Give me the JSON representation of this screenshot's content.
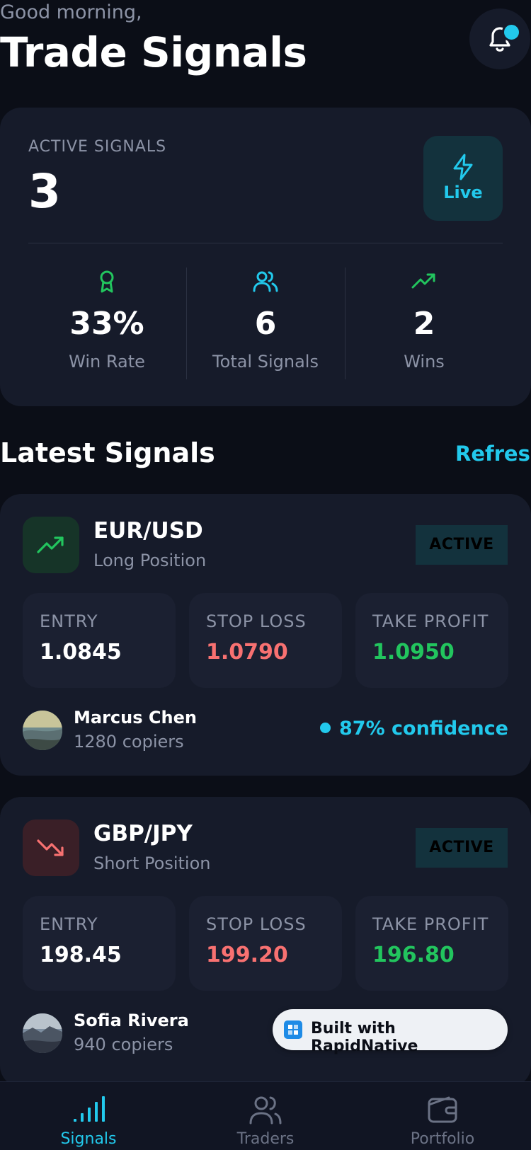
{
  "header": {
    "greeting": "Good morning,",
    "title": "Trade Signals",
    "notification_icon": "bell-icon"
  },
  "stats": {
    "active_label": "ACTIVE SIGNALS",
    "active_value": "3",
    "live_label": "Live",
    "items": [
      {
        "icon": "award-icon",
        "value": "33%",
        "label": "Win Rate",
        "color": "#22c55e"
      },
      {
        "icon": "users-icon",
        "value": "6",
        "label": "Total Signals",
        "color": "#22c9ec"
      },
      {
        "icon": "trending-up-icon",
        "value": "2",
        "label": "Wins",
        "color": "#22c55e"
      }
    ]
  },
  "latest": {
    "title": "Latest Signals",
    "refresh_label": "Refresh"
  },
  "signals": [
    {
      "pair": "EUR/USD",
      "position": "Long Position",
      "status": "ACTIVE",
      "entry_label": "ENTRY",
      "entry": "1.0845",
      "stop_label": "STOP LOSS",
      "stop": "1.0790",
      "take_label": "TAKE PROFIT",
      "take": "1.0950",
      "trader": "Marcus Chen",
      "copiers": "1280 copiers",
      "confidence": "87% confidence"
    },
    {
      "pair": "GBP/JPY",
      "position": "Short Position",
      "status": "ACTIVE",
      "entry_label": "ENTRY",
      "entry": "198.45",
      "stop_label": "STOP LOSS",
      "stop": "199.20",
      "take_label": "TAKE PROFIT",
      "take": "196.80",
      "trader": "Sofia Rivera",
      "copiers": "940 copiers"
    }
  ],
  "badge": {
    "label": "Built with RapidNative"
  },
  "tabs": [
    {
      "label": "Signals",
      "icon": "signal-bars-icon",
      "active": true
    },
    {
      "label": "Traders",
      "icon": "users-icon",
      "active": false
    },
    {
      "label": "Portfolio",
      "icon": "wallet-icon",
      "active": false
    }
  ],
  "colors": {
    "accent": "#22c9ec",
    "green": "#22c55e",
    "red": "#f87171",
    "background": "#0b0e17",
    "card": "#161b2a"
  }
}
